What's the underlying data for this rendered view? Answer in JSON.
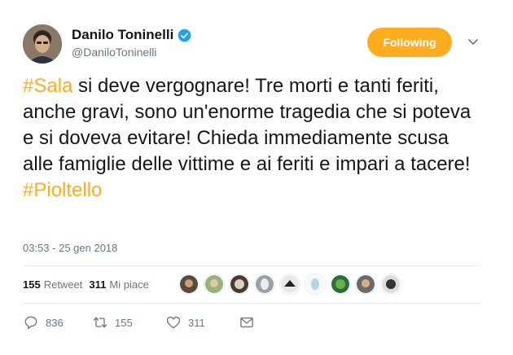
{
  "profile": {
    "name": "Danilo Toninelli",
    "handle": "@DaniloToninelli",
    "follow_label": "Following"
  },
  "tweet": {
    "hashtag1": "#Sala",
    "text_body": " si deve vergognare! Tre morti e tanti feriti, anche gravi, sono un'enorme tragedia che si poteva e si doveva evitare! Chieda immediamente scusa alle famiglie delle vittime e ai feriti e impari a tacere! ",
    "hashtag2": "#Pioltello",
    "timestamp": "03:53 - 25 gen 2018"
  },
  "stats": {
    "retweets": "155",
    "retweets_label": "Retweet",
    "likes": "311",
    "likes_label": "Mi piace"
  },
  "actions": {
    "reply_count": "836",
    "retweet_count": "155",
    "like_count": "311"
  },
  "colors": {
    "accent": "#ffad1f",
    "verified": "#1da1f2",
    "muted": "#657786"
  }
}
